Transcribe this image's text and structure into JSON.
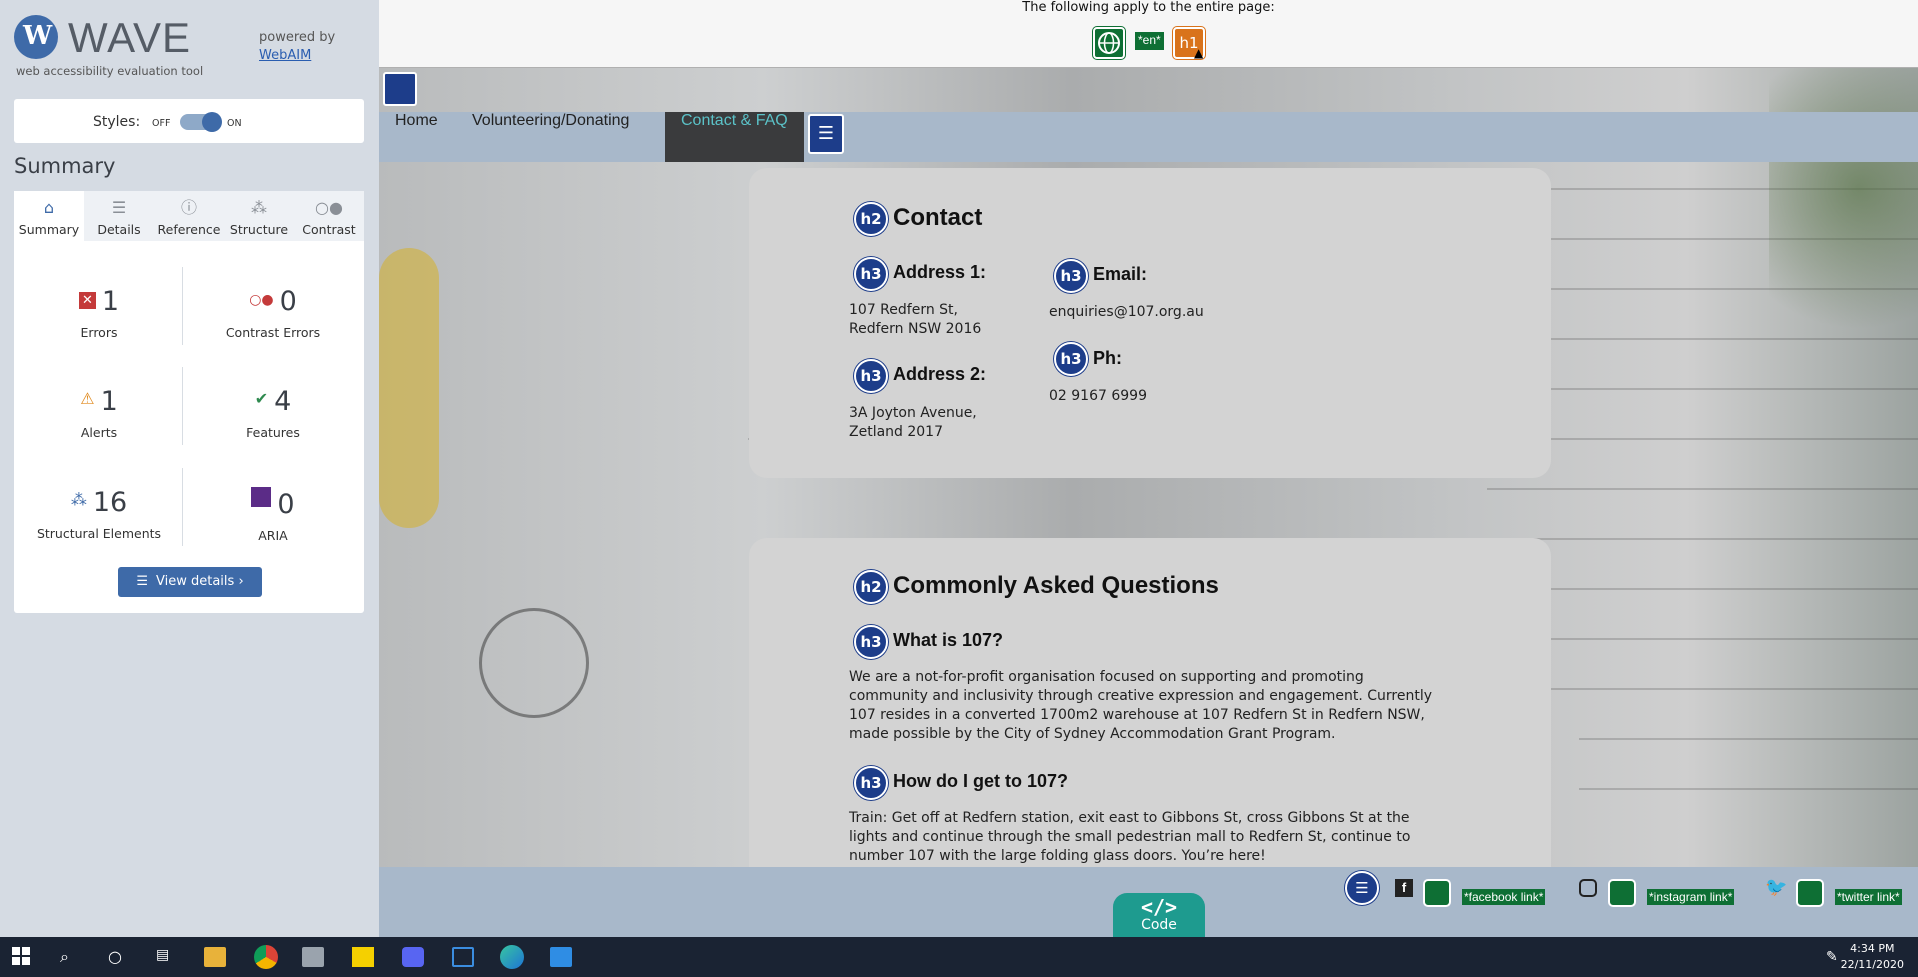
{
  "wave": {
    "logo_letter": "W",
    "logo_text": "WAVE",
    "tagline": "web accessibility evaluation tool",
    "powered_by": "powered by",
    "webaim_link": "WebAIM",
    "styles_label": "Styles:",
    "styles_off": "OFF",
    "styles_on": "ON",
    "summary_heading": "Summary",
    "tabs": [
      {
        "label": "Summary",
        "icon": "home-icon"
      },
      {
        "label": "Details",
        "icon": "list-icon"
      },
      {
        "label": "Reference",
        "icon": "info-icon"
      },
      {
        "label": "Structure",
        "icon": "structure-icon"
      },
      {
        "label": "Contrast",
        "icon": "contrast-icon"
      }
    ],
    "stats": {
      "errors": {
        "count": "1",
        "label": "Errors"
      },
      "contrast_errors": {
        "count": "0",
        "label": "Contrast Errors"
      },
      "alerts": {
        "count": "1",
        "label": "Alerts"
      },
      "features": {
        "count": "4",
        "label": "Features"
      },
      "structural": {
        "count": "16",
        "label": "Structural Elements"
      },
      "aria": {
        "count": "0",
        "label": "ARIA"
      }
    },
    "view_details": "View details ›"
  },
  "page_summary": {
    "text": "The following apply to the entire page:",
    "lang_badge": "*en*",
    "h1_badge": "h1"
  },
  "site": {
    "nav": [
      "Home",
      "Volunteering/Donating",
      "Contact & FAQ"
    ],
    "contact": {
      "heading": "Contact",
      "address1_label": "Address 1:",
      "address1_line1": "107 Redfern St,",
      "address1_line2": "Redfern NSW 2016",
      "address2_label": "Address 2:",
      "address2_line1": "3A Joyton Avenue,",
      "address2_line2": "Zetland 2017",
      "email_label": "Email:",
      "email_value": "enquiries@107.org.au",
      "phone_label": "Ph:",
      "phone_value": "02 9167 6999"
    },
    "faq": {
      "heading": "Commonly Asked Questions",
      "q1": "What is 107?",
      "a1_lines": [
        "We are a not-for-profit organisation focused on supporting and promoting",
        "community and inclusivity through creative expression and engagement. Currently",
        "107 resides in a converted 1700m2 warehouse at 107 Redfern St in Redfern NSW,",
        "made possible by the City of Sydney Accommodation Grant Program."
      ],
      "q2": "How do I get to 107?",
      "a2_lines": [
        "Train: Get off at Redfern station, exit east to Gibbons St, cross Gibbons St at the",
        "lights and continue through the small pedestrian mall to Redfern St, continue to",
        "number 107 with the large folding glass doors. You’re here!"
      ]
    },
    "h2_badge": "h2",
    "h3_badge": "h3",
    "footer": {
      "facebook": "*facebook link*",
      "instagram": "*instagram link*",
      "twitter": "*twitter link*"
    },
    "code_label": "Code",
    "code_symbol": "</>"
  },
  "taskbar": {
    "time": "4:34 PM",
    "date": "22/11/2020"
  }
}
